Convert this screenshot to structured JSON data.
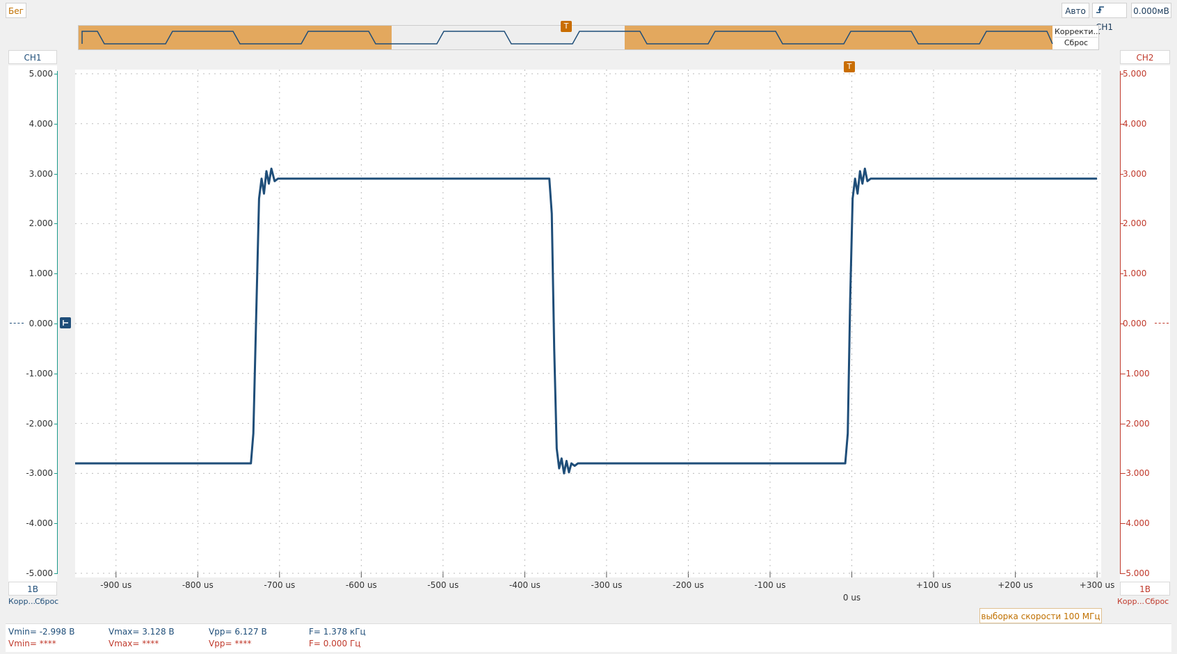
{
  "toolbar": {
    "run_label": "Бег",
    "mode_label": "Авто",
    "trigger_channel": "CH1",
    "trigger_level": "0.000мВ"
  },
  "overview": {
    "correct_label": "Корректи...",
    "reset_label": "Сброс",
    "trigger_marker": "T"
  },
  "ch1": {
    "name": "CH1",
    "scale": "1В",
    "correct_label": "Корр...",
    "reset_label": "Сброс",
    "color": "#1f4e79"
  },
  "ch2": {
    "name": "CH2",
    "scale": "1В",
    "correct_label": "Корр...",
    "reset_label": "Сброс",
    "color": "#c0392b"
  },
  "y_ticks": [
    "5.000",
    "4.000",
    "3.000",
    "2.000",
    "1.000",
    "0.000",
    "-1.000",
    "-2.000",
    "-3.000",
    "-4.000",
    "-5.000"
  ],
  "x_ticks": [
    "-900 us",
    "-800 us",
    "-700 us",
    "-600 us",
    "-500 us",
    "-400 us",
    "-300 us",
    "-200 us",
    "-100 us",
    "0 us",
    "+100 us",
    "+200 us",
    "+300 us"
  ],
  "trigger_marker": "T",
  "sample_rate": "выборка скорости 100 МГц",
  "measurements": {
    "ch1": {
      "vmin": "Vmin= -2.998 В",
      "vmax": "Vmax= 3.128 В",
      "vpp": "Vpp= 6.127 В",
      "freq": "F= 1.378 кГц"
    },
    "ch2": {
      "vmin": "Vmin= ****",
      "vmax": "Vmax= ****",
      "vpp": "Vpp= ****",
      "freq": "F= 0.000 Гц"
    }
  },
  "chart_data": {
    "type": "line",
    "xlim": [
      -950,
      305
    ],
    "ylim": [
      -5,
      5
    ],
    "grid": true,
    "series": [
      {
        "x": [
          -950,
          -735,
          -732,
          -728,
          -725,
          -722,
          -719,
          -716,
          -713,
          -710,
          -706,
          -702,
          -370,
          -367,
          -364,
          -361,
          -358,
          -355,
          -352,
          -349,
          -346,
          -343,
          -339,
          -335,
          -8,
          -5,
          -2,
          1,
          4,
          7,
          10,
          13,
          16,
          19,
          23,
          27,
          300
        ],
        "y": [
          -2.8,
          -2.8,
          -2.2,
          0.5,
          2.5,
          2.9,
          2.6,
          3.05,
          2.8,
          3.1,
          2.85,
          2.9,
          2.9,
          2.2,
          -0.5,
          -2.5,
          -2.9,
          -2.7,
          -3.0,
          -2.75,
          -2.98,
          -2.8,
          -2.85,
          -2.8,
          -2.8,
          -2.2,
          0.5,
          2.5,
          2.9,
          2.6,
          3.05,
          2.8,
          3.1,
          2.85,
          2.9,
          2.9,
          2.9
        ]
      }
    ]
  }
}
